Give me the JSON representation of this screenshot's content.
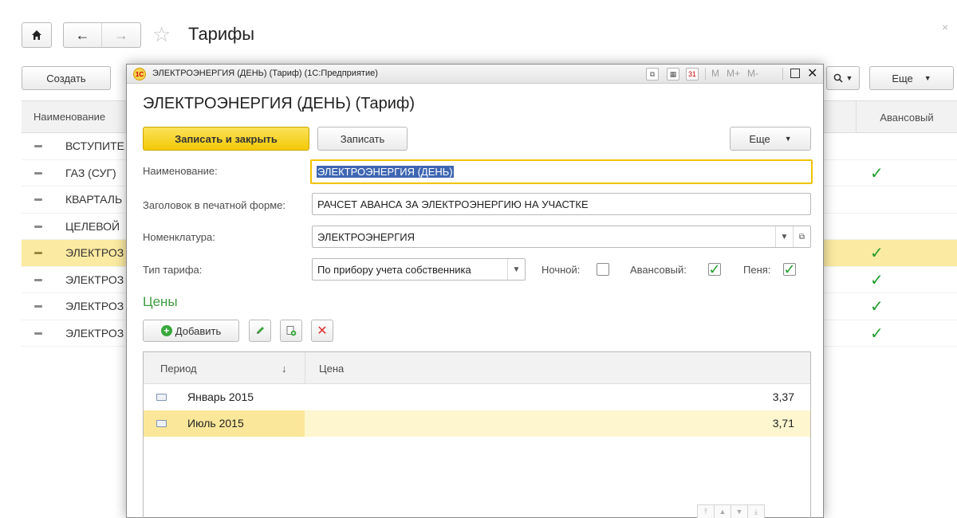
{
  "background": {
    "title": "Тарифы",
    "toolbar": {
      "create_label": "Создать",
      "more_label": "Еще"
    },
    "table": {
      "columns": {
        "name": "Наименование",
        "advance": "Авансовый"
      },
      "rows": [
        {
          "name": "ВСТУПИТЕ",
          "advance": ""
        },
        {
          "name": "ГАЗ (СУГ)",
          "advance": "✓"
        },
        {
          "name": "КВАРТАЛЬ",
          "advance": ""
        },
        {
          "name": "ЦЕЛЕВОЙ",
          "advance": ""
        },
        {
          "name": "ЭЛЕКТРОЗ",
          "advance": "✓"
        },
        {
          "name": "ЭЛЕКТРОЗ",
          "advance": "✓"
        },
        {
          "name": "ЭЛЕКТРОЗ",
          "advance": "✓"
        },
        {
          "name": "ЭЛЕКТРОЗ",
          "advance": "✓"
        }
      ]
    }
  },
  "dialog": {
    "window_title": "ЭЛЕКТРОЭНЕРГИЯ (ДЕНЬ) (Тариф)  (1С:Предприятие)",
    "app_icon_text": "1С",
    "titlebar_memory": [
      "M",
      "M+",
      "M-"
    ],
    "heading": "ЭЛЕКТРОЭНЕРГИЯ (ДЕНЬ) (Тариф)",
    "buttons": {
      "save_close": "Записать и закрыть",
      "save": "Записать",
      "more": "Еще"
    },
    "fields": {
      "name": {
        "label": "Наименование:",
        "value": "ЭЛЕКТРОЭНЕРГИЯ (ДЕНЬ)"
      },
      "print_title": {
        "label": "Заголовок в печатной форме:",
        "value": "РАЧСЕТ АВАНСА ЗА ЭЛЕКТРОЭНЕРГИЮ НА УЧАСТКЕ"
      },
      "nomenclature": {
        "label": "Номенклатура:",
        "value": "ЭЛЕКТРОЭНЕРГИЯ"
      },
      "tariff_type": {
        "label": "Тип тарифа:",
        "value": "По прибору учета собственника"
      }
    },
    "checkboxes": {
      "night": {
        "label": "Ночной:",
        "checked": false
      },
      "advance": {
        "label": "Авансовый:",
        "checked": true
      },
      "penalty": {
        "label": "Пеня:",
        "checked": true
      }
    },
    "prices": {
      "section_title": "Цены",
      "add_label": "Добавить",
      "columns": {
        "period": "Период",
        "sort_indicator": "↓",
        "price": "Цена"
      },
      "rows": [
        {
          "period": "Январь 2015",
          "price": "3,37"
        },
        {
          "period": "Июль 2015",
          "price": "3,71"
        }
      ]
    }
  },
  "colors": {
    "accent_yellow": "#f3c905",
    "selection_row": "#fbeaa1",
    "check_green": "#1f9e2c",
    "section_green": "#3e9d3e"
  }
}
